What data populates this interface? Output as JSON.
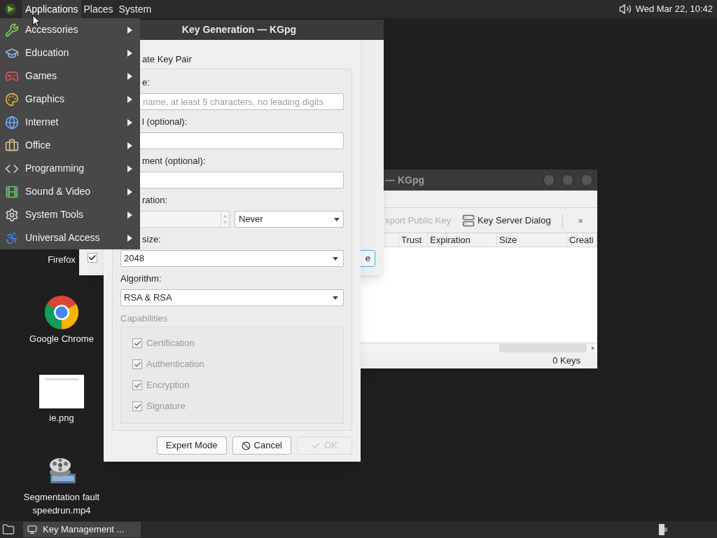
{
  "top_panel": {
    "menus": [
      {
        "label": "Applications",
        "selected": true
      },
      {
        "label": "Places",
        "selected": false
      },
      {
        "label": "System",
        "selected": false
      }
    ],
    "clock": "Wed Mar 22, 10:42"
  },
  "applications_menu": {
    "items": [
      {
        "label": "Accessories"
      },
      {
        "label": "Education"
      },
      {
        "label": "Games"
      },
      {
        "label": "Graphics"
      },
      {
        "label": "Internet"
      },
      {
        "label": "Office"
      },
      {
        "label": "Programming"
      },
      {
        "label": "Sound & Video"
      },
      {
        "label": "System Tools"
      },
      {
        "label": "Universal Access"
      }
    ]
  },
  "back_window": {
    "checkbox": {
      "checked": true
    },
    "button": "e"
  },
  "main_window": {
    "title": "— KGpg",
    "toolbar": [
      {
        "label": "xport Public Key",
        "disabled": true
      },
      {
        "label": "Key Server Dialog",
        "disabled": false
      }
    ],
    "overflow": "»",
    "columns": [
      "Trust",
      "Expiration",
      "Size",
      "Creati"
    ],
    "status": "0 Keys"
  },
  "dialog": {
    "title": "Key Generation — KGpg",
    "heading": "ate Key Pair",
    "fields": [
      {
        "kind": "text",
        "label": "e:",
        "placeholder": "name, at least 5 characters, no leading digits",
        "clipped": true
      },
      {
        "kind": "text",
        "label": "l (optional):",
        "clipped": true
      },
      {
        "kind": "text",
        "label": "ment (optional):",
        "clipped": true
      },
      {
        "kind": "spin_combo",
        "label": "ration:",
        "value": "Never",
        "clipped": true
      },
      {
        "kind": "combo",
        "label": "size:",
        "value": "2048",
        "clipped": true
      },
      {
        "kind": "combo",
        "label": "Algorithm:",
        "value": "RSA & RSA"
      }
    ],
    "capabilities": {
      "label": "Capabilities",
      "disabled": true,
      "items": [
        {
          "label": "Certification",
          "checked": true
        },
        {
          "label": "Authentication",
          "checked": true
        },
        {
          "label": "Encryption",
          "checked": true
        },
        {
          "label": "Signature",
          "checked": true
        }
      ]
    },
    "buttons": [
      {
        "label": "Expert Mode",
        "kind": "plain",
        "disabled": false
      },
      {
        "label": "Cancel",
        "kind": "cancel",
        "disabled": false
      },
      {
        "label": "OK",
        "kind": "ok",
        "disabled": true
      }
    ]
  },
  "desktop_icons": [
    {
      "label": "Firefox",
      "kind": "hidden"
    },
    {
      "label": "Google Chrome",
      "kind": "chrome"
    },
    {
      "label": "ie.png",
      "kind": "picture"
    },
    {
      "label": "Segmentation fault speedrun.mp4",
      "kind": "video"
    }
  ],
  "taskbar": {
    "tasks": [
      {
        "label": "Key Management ...",
        "selected": true
      }
    ]
  }
}
